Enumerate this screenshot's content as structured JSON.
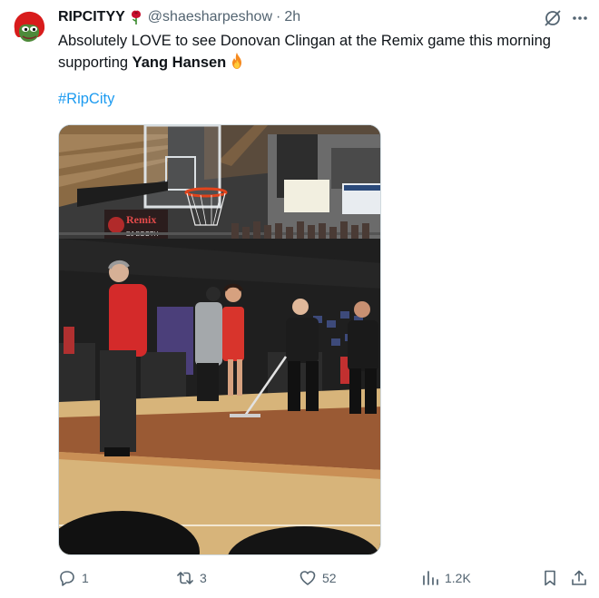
{
  "author": {
    "display_name": "RIPCITYY",
    "handle": "@shaesharpeshow",
    "separator": "·",
    "time": "2h",
    "avatar_icon": "frog-avatar-icon",
    "name_emoji_icon": "rose-icon"
  },
  "tweet": {
    "text_part1": "Absolutely LOVE to see Donovan Clingan at the Remix game this morning supporting ",
    "text_bold": "Yang Hansen",
    "emoji_icon": "fire-icon",
    "hashtag": "#RipCity"
  },
  "media": {
    "description_icon": "photo-basketball-court",
    "banner_text": "Remix",
    "banner_subtext": "DJ BOOTH"
  },
  "actions": {
    "replies": "1",
    "retweets": "3",
    "likes": "52",
    "views": "1.2K"
  },
  "colors": {
    "accent": "#1d9bf0",
    "text_primary": "#0f1419",
    "text_secondary": "#536471",
    "avatar_red": "#d81c1c"
  }
}
